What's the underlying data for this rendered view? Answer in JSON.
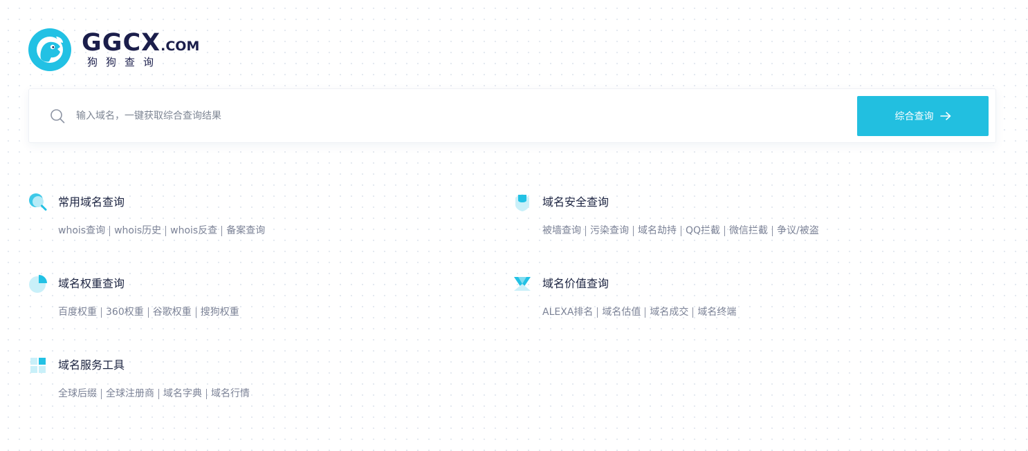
{
  "logo": {
    "name": "GGCX",
    "domain_suffix": ".COM",
    "subtitle": "狗狗查询"
  },
  "search": {
    "placeholder": "输入域名，一键获取综合查询结果",
    "value": "",
    "button_label": "综合查询"
  },
  "colors": {
    "accent": "#22bfe0",
    "brand_dark": "#1b1e4b",
    "link": "#7b8296"
  },
  "categories": [
    {
      "title": "常用域名查询",
      "icon": "magnifier-icon",
      "links": [
        "whois查询",
        "whois历史",
        "whois反查",
        "备案查询"
      ]
    },
    {
      "title": "域名安全查询",
      "icon": "shield-icon",
      "links": [
        "被墙查询",
        "污染查询",
        "域名劫持",
        "QQ拦截",
        "微信拦截",
        "争议/被盗"
      ]
    },
    {
      "title": "域名权重查询",
      "icon": "pie-chart-icon",
      "links": [
        "百度权重",
        "360权重",
        "谷歌权重",
        "搜狗权重"
      ]
    },
    {
      "title": "域名价值查询",
      "icon": "diamond-icon",
      "links": [
        "ALEXA排名",
        "域名估值",
        "域名成交",
        "域名终端"
      ]
    },
    {
      "title": "域名服务工具",
      "icon": "grid-icon",
      "links": [
        "全球后缀",
        "全球注册商",
        "域名字典",
        "域名行情"
      ]
    }
  ]
}
